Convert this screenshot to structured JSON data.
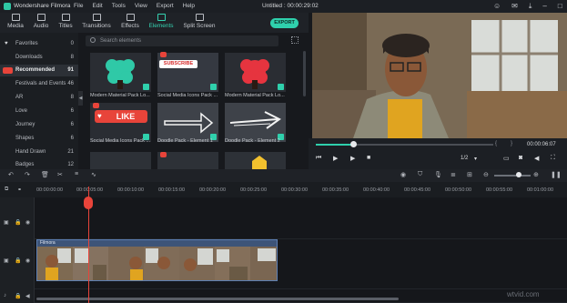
{
  "titlebar": {
    "app_name": "Wondershare Filmora",
    "menus": [
      "File",
      "Edit",
      "Tools",
      "View",
      "Export",
      "Help"
    ],
    "project_title": "Untitled : 00:00:29:02"
  },
  "toolbar": {
    "tabs": [
      "Media",
      "Audio",
      "Titles",
      "Transitions",
      "Effects",
      "Elements",
      "Split Screen"
    ],
    "active_tab": "Elements",
    "export_label": "EXPORT"
  },
  "sidebar": {
    "items": [
      {
        "label": "Favorites",
        "count": "0"
      },
      {
        "label": "Downloads",
        "count": "8"
      },
      {
        "label": "Recommended",
        "count": "91"
      },
      {
        "label": "Festivals and Events",
        "count": "46"
      },
      {
        "label": "AR",
        "count": "8"
      },
      {
        "label": "Love",
        "count": "6"
      },
      {
        "label": "Journey",
        "count": "6"
      },
      {
        "label": "Shapes",
        "count": "6"
      },
      {
        "label": "Hand Drawn",
        "count": "21"
      },
      {
        "label": "Badges",
        "count": "12"
      }
    ],
    "active": "Recommended"
  },
  "elements": {
    "search_placeholder": "Search elements",
    "items": [
      {
        "caption": "Modern Material Pack Lo...",
        "text": ""
      },
      {
        "caption": "Social Media Icons Pack ...",
        "text": "SUBSCRIBE"
      },
      {
        "caption": "Modern Material Pack Lo...",
        "text": ""
      },
      {
        "caption": "Social Media Icons Pack ...",
        "text": "LIKE"
      },
      {
        "caption": "Doodle Pack - Element 1",
        "text": ""
      },
      {
        "caption": "Doodle Pack - Element 2",
        "text": ""
      }
    ]
  },
  "preview": {
    "progress": 0.21,
    "page_indicator": "1/2",
    "timecode": "00:00:06:07"
  },
  "timeline": {
    "ticks": [
      "00:00:00:00",
      "00:00:05:00",
      "00:00:10:00",
      "00:00:15:00",
      "00:00:20:00",
      "00:00:25:00",
      "00:00:30:00",
      "00:00:35:00",
      "00:00:40:00",
      "00:00:45:00",
      "00:00:50:00",
      "00:00:55:00",
      "00:01:00:00"
    ],
    "clip_label": "Filmora"
  },
  "watermark": "wtvid.com",
  "colors": {
    "accent": "#2fd0ac",
    "playhead": "#e8443a",
    "clip": "#3d5478"
  }
}
